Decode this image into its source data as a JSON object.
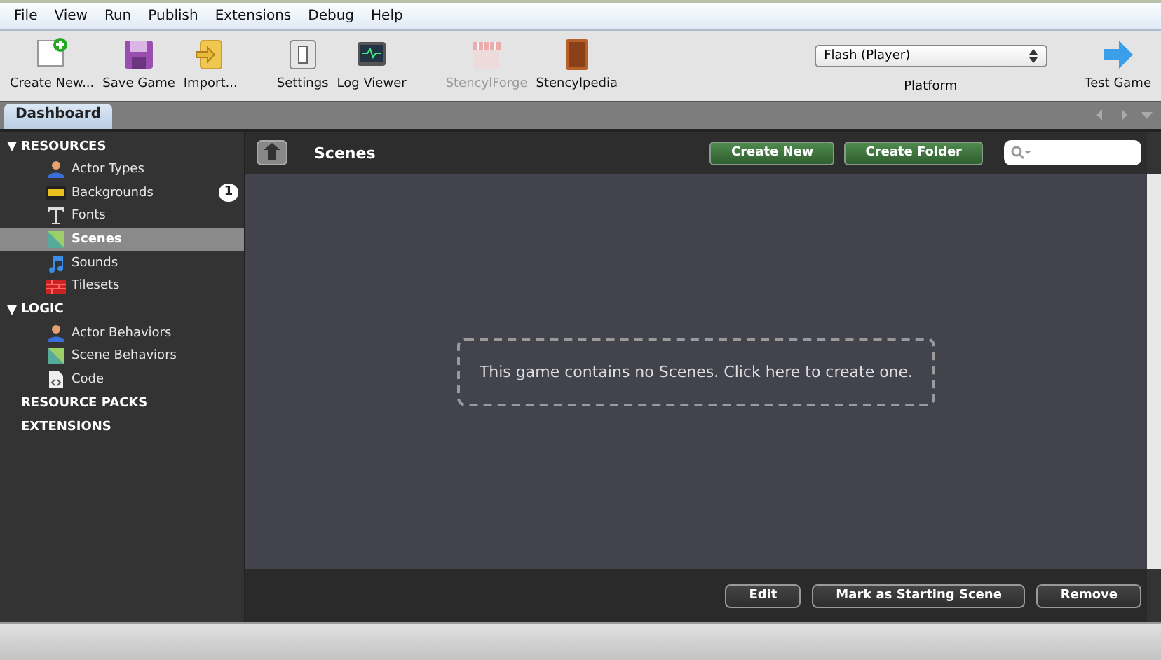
{
  "menu": [
    "File",
    "View",
    "Run",
    "Publish",
    "Extensions",
    "Debug",
    "Help"
  ],
  "toolbar": [
    {
      "kind": "new",
      "label": "Create New...",
      "disabled": false
    },
    {
      "kind": "save",
      "label": "Save Game",
      "disabled": false
    },
    {
      "kind": "import",
      "label": "Import...",
      "disabled": false
    },
    {
      "kind": "gap"
    },
    {
      "kind": "settings",
      "label": "Settings",
      "disabled": false
    },
    {
      "kind": "log",
      "label": "Log Viewer",
      "disabled": false
    },
    {
      "kind": "gap"
    },
    {
      "kind": "forge",
      "label": "StencylForge",
      "disabled": true
    },
    {
      "kind": "book",
      "label": "Stencylpedia",
      "disabled": false
    }
  ],
  "platform": {
    "value": "Flash (Player)",
    "label": "Platform"
  },
  "test_button": {
    "label": "Test Game"
  },
  "tabs": [
    {
      "label": "Dashboard",
      "selected": true
    }
  ],
  "sidebar": [
    {
      "label": "RESOURCES",
      "expanded": true,
      "children": [
        {
          "label": "Actor Types",
          "kind": "actor",
          "selected": false
        },
        {
          "label": "Backgrounds",
          "kind": "background",
          "selected": false,
          "badge": "1"
        },
        {
          "label": "Fonts",
          "kind": "font",
          "selected": false
        },
        {
          "label": "Scenes",
          "kind": "scene",
          "selected": true
        },
        {
          "label": "Sounds",
          "kind": "sound",
          "selected": false
        },
        {
          "label": "Tilesets",
          "kind": "tileset",
          "selected": false
        }
      ]
    },
    {
      "label": "LOGIC",
      "expanded": true,
      "children": [
        {
          "label": "Actor Behaviors",
          "kind": "actor",
          "selected": false
        },
        {
          "label": "Scene Behaviors",
          "kind": "scene",
          "selected": false
        },
        {
          "label": "Code",
          "kind": "code",
          "selected": false
        }
      ]
    },
    {
      "label": "RESOURCE PACKS",
      "expanded": false
    },
    {
      "label": "EXTENSIONS",
      "expanded": false
    }
  ],
  "panel": {
    "title": "Scenes",
    "buttons": [
      "Create New",
      "Create Folder"
    ],
    "empty_message": "This game contains no Scenes. Click here to create one.",
    "footer_buttons": [
      "Edit",
      "Mark as Starting Scene",
      "Remove"
    ]
  }
}
